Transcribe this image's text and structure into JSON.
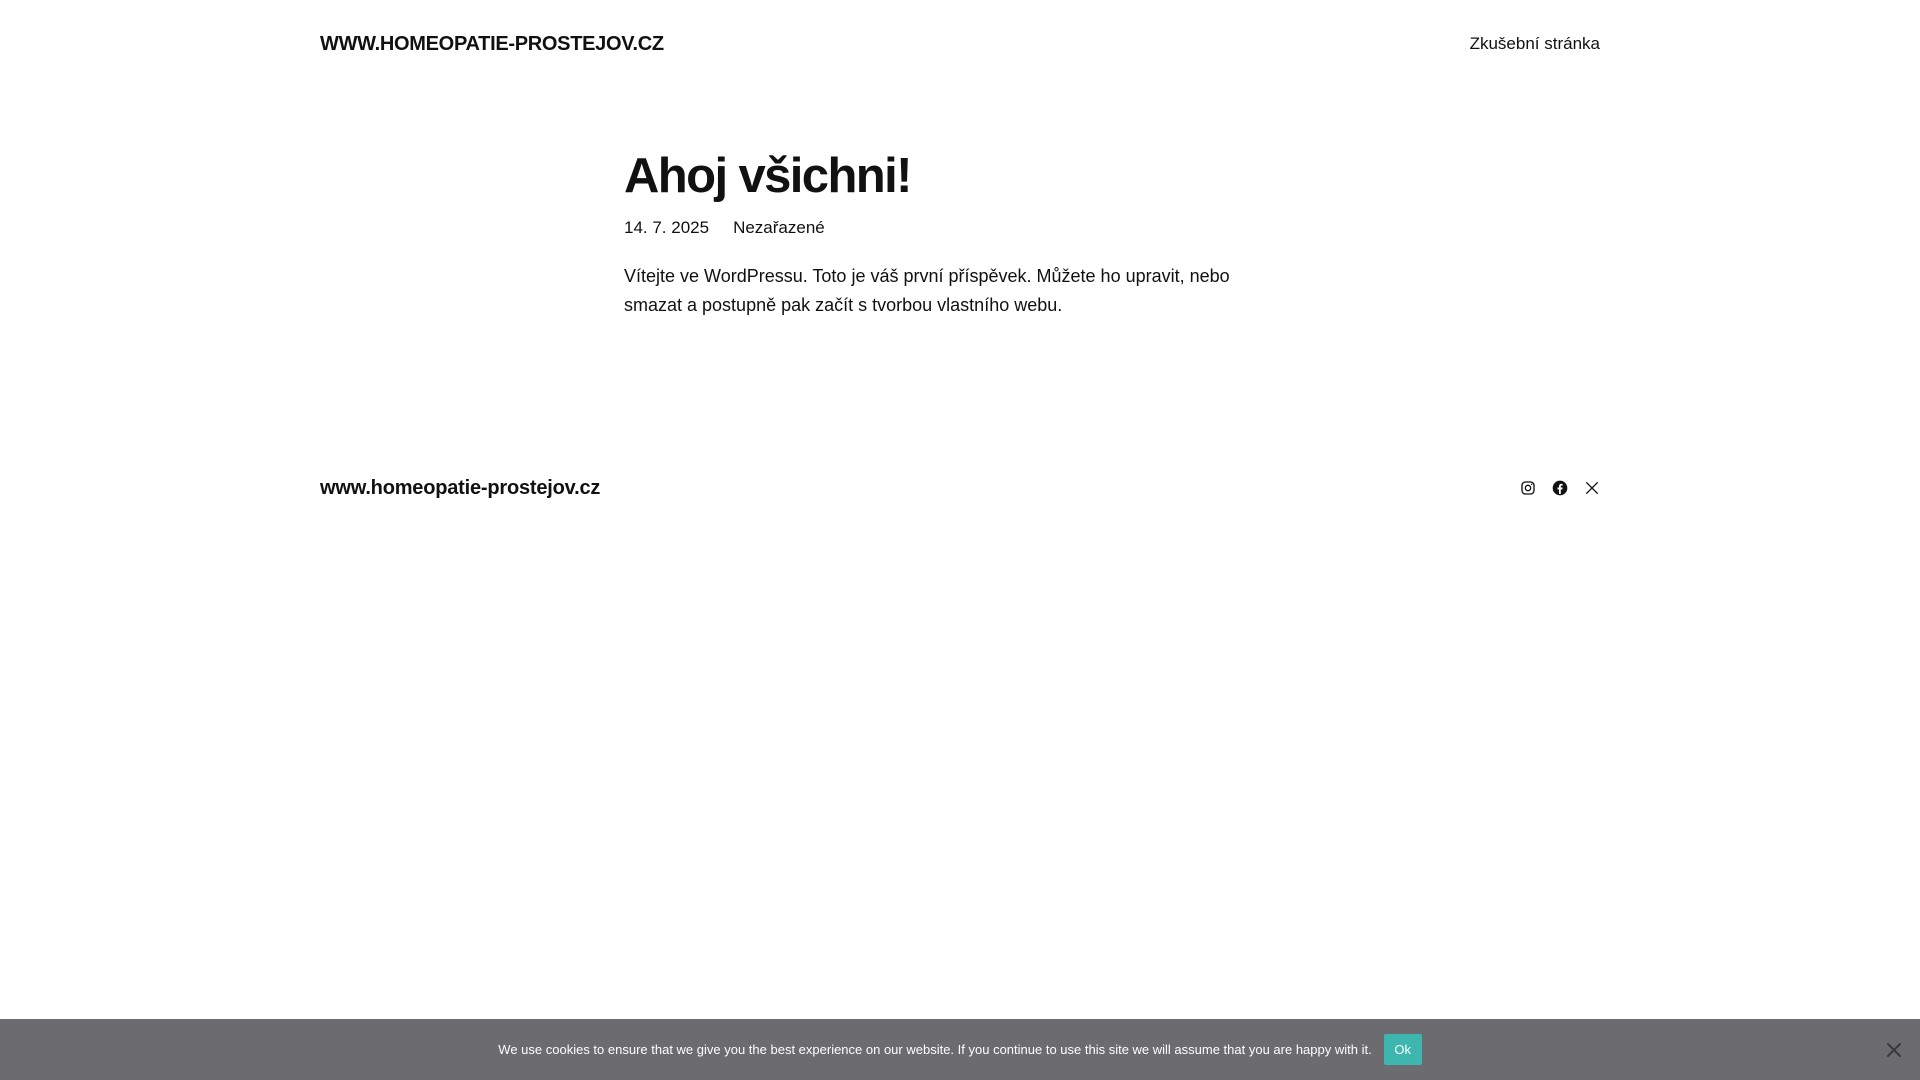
{
  "header": {
    "site_title": "WWW.HOMEOPATIE-PROSTEJOV.CZ",
    "nav": [
      {
        "label": "Zkušební stránka"
      }
    ]
  },
  "post": {
    "title": "Ahoj všichni!",
    "date": "14. 7. 2025",
    "category": "Nezařazené",
    "content": "Vítejte ve WordPressu. Toto je váš první příspěvek. Můžete ho upravit, nebo smazat a postupně pak začít s tvorbou vlastního webu."
  },
  "footer": {
    "site_title": "www.homeopatie-prostejov.cz",
    "social": [
      {
        "icon": "instagram-icon"
      },
      {
        "icon": "facebook-icon"
      },
      {
        "icon": "x-icon"
      }
    ]
  },
  "cookie_notice": {
    "text": "We use cookies to ensure that we give you the best experience on our website. If you continue to use this site we will assume that you are happy with it.",
    "ok_label": "Ok",
    "close_icon": "close-icon",
    "background": "#6b6b70",
    "button_color": "#3db6b0"
  }
}
